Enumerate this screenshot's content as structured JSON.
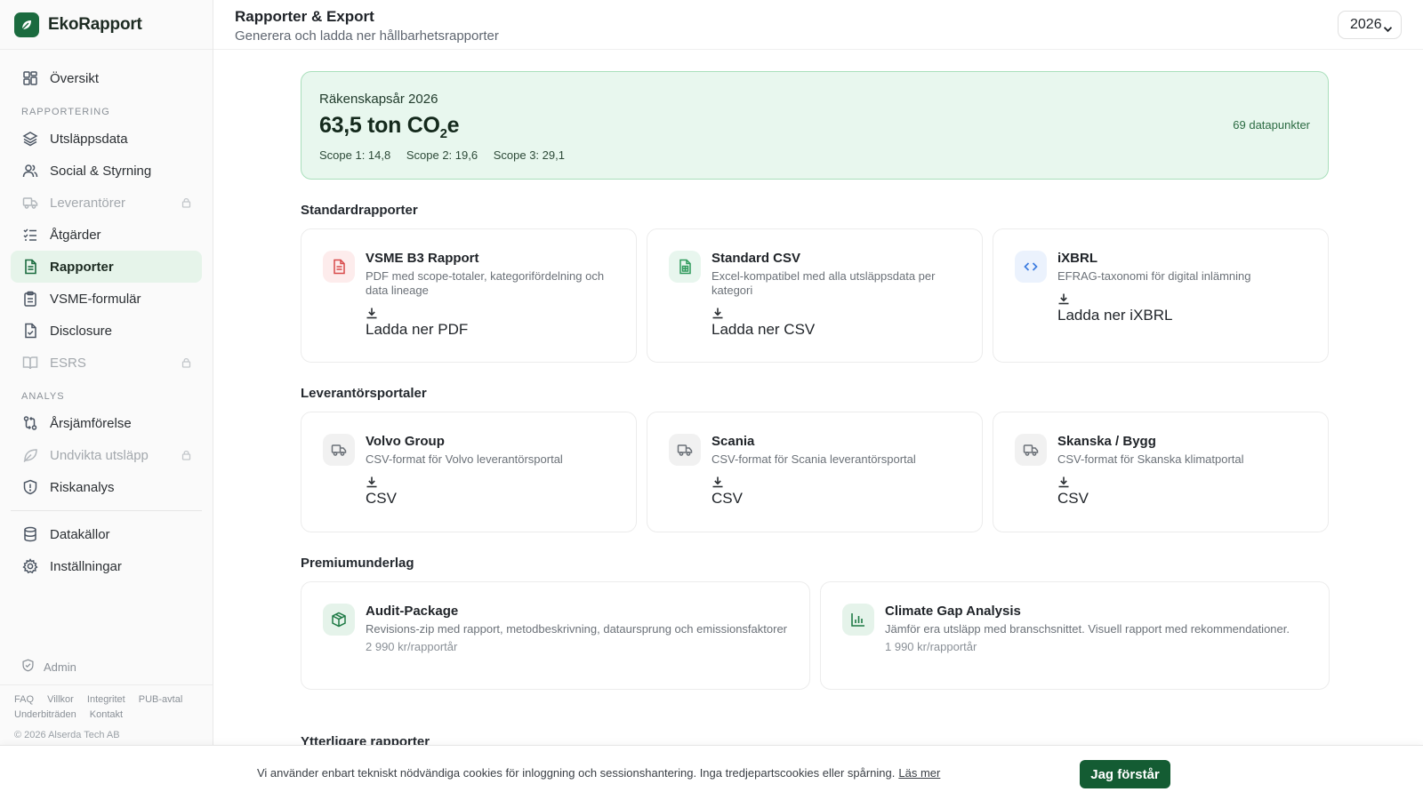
{
  "brand": {
    "name": "EkoRapport"
  },
  "sidebar": {
    "overview": {
      "label": "Översikt"
    },
    "section_reporting": "RAPPORTERING",
    "reporting": [
      {
        "label": "Utsläppsdata"
      },
      {
        "label": "Social & Styrning"
      },
      {
        "label": "Leverantörer"
      },
      {
        "label": "Åtgärder"
      },
      {
        "label": "Rapporter"
      },
      {
        "label": "VSME-formulär"
      },
      {
        "label": "Disclosure"
      },
      {
        "label": "ESRS"
      }
    ],
    "section_analysis": "ANALYS",
    "analysis": [
      {
        "label": "Årsjämförelse"
      },
      {
        "label": "Undvikta utsläpp"
      },
      {
        "label": "Riskanalys"
      }
    ],
    "data_sources": {
      "label": "Datakällor"
    },
    "settings": {
      "label": "Inställningar"
    },
    "admin": {
      "label": "Admin"
    },
    "footer_links": [
      "FAQ",
      "Villkor",
      "Integritet",
      "PUB-avtal",
      "Underbiträden",
      "Kontakt"
    ],
    "copyright": "© 2026 Alserda Tech AB"
  },
  "header": {
    "title": "Rapporter & Export",
    "subtitle": "Generera och ladda ner hållbarhetsrapporter",
    "year": "2026"
  },
  "summary": {
    "label": "Räkenskapsår 2026",
    "value_prefix": "63,5 ton CO",
    "value_sub": "2",
    "value_suffix": "e",
    "scope1": "Scope 1: 14,8",
    "scope2": "Scope 2: 19,6",
    "scope3": "Scope 3: 29,1",
    "datapoints": "69 datapunkter"
  },
  "standard": {
    "title": "Standardrapporter",
    "cards": [
      {
        "title": "VSME B3 Rapport",
        "desc": "PDF med scope-totaler, kategorifördelning och data lineage",
        "action": "Ladda ner PDF"
      },
      {
        "title": "Standard CSV",
        "desc": "Excel-kompatibel med alla utsläppsdata per kategori",
        "action": "Ladda ner CSV"
      },
      {
        "title": "iXBRL",
        "desc": "EFRAG-taxonomi för digital inlämning",
        "action": "Ladda ner iXBRL"
      }
    ]
  },
  "suppliers": {
    "title": "Leverantörsportaler",
    "cards": [
      {
        "title": "Volvo Group",
        "desc": "CSV-format för Volvo leverantörsportal",
        "action": "CSV"
      },
      {
        "title": "Scania",
        "desc": "CSV-format för Scania leverantörsportal",
        "action": "CSV"
      },
      {
        "title": "Skanska / Bygg",
        "desc": "CSV-format för Skanska klimatportal",
        "action": "CSV"
      }
    ]
  },
  "premium": {
    "title": "Premiumunderlag",
    "cards": [
      {
        "title": "Audit-Package",
        "desc": "Revisions-zip med rapport, metodbeskrivning, dataursprung och emissionsfaktorer",
        "price": "2 990 kr/rapportår"
      },
      {
        "title": "Climate Gap Analysis",
        "desc": "Jämför era utsläpp med branschsnittet. Visuell rapport med rekommendationer.",
        "price": "1 990 kr/rapportår"
      }
    ]
  },
  "next_section_title": "Ytterligare rapporter",
  "cookie": {
    "text": "Vi använder enbart tekniskt nödvändiga cookies för inloggning och sessionshantering. Inga tredjepartscookies eller spårning.",
    "link": "Läs mer",
    "button": "Jag förstår"
  }
}
